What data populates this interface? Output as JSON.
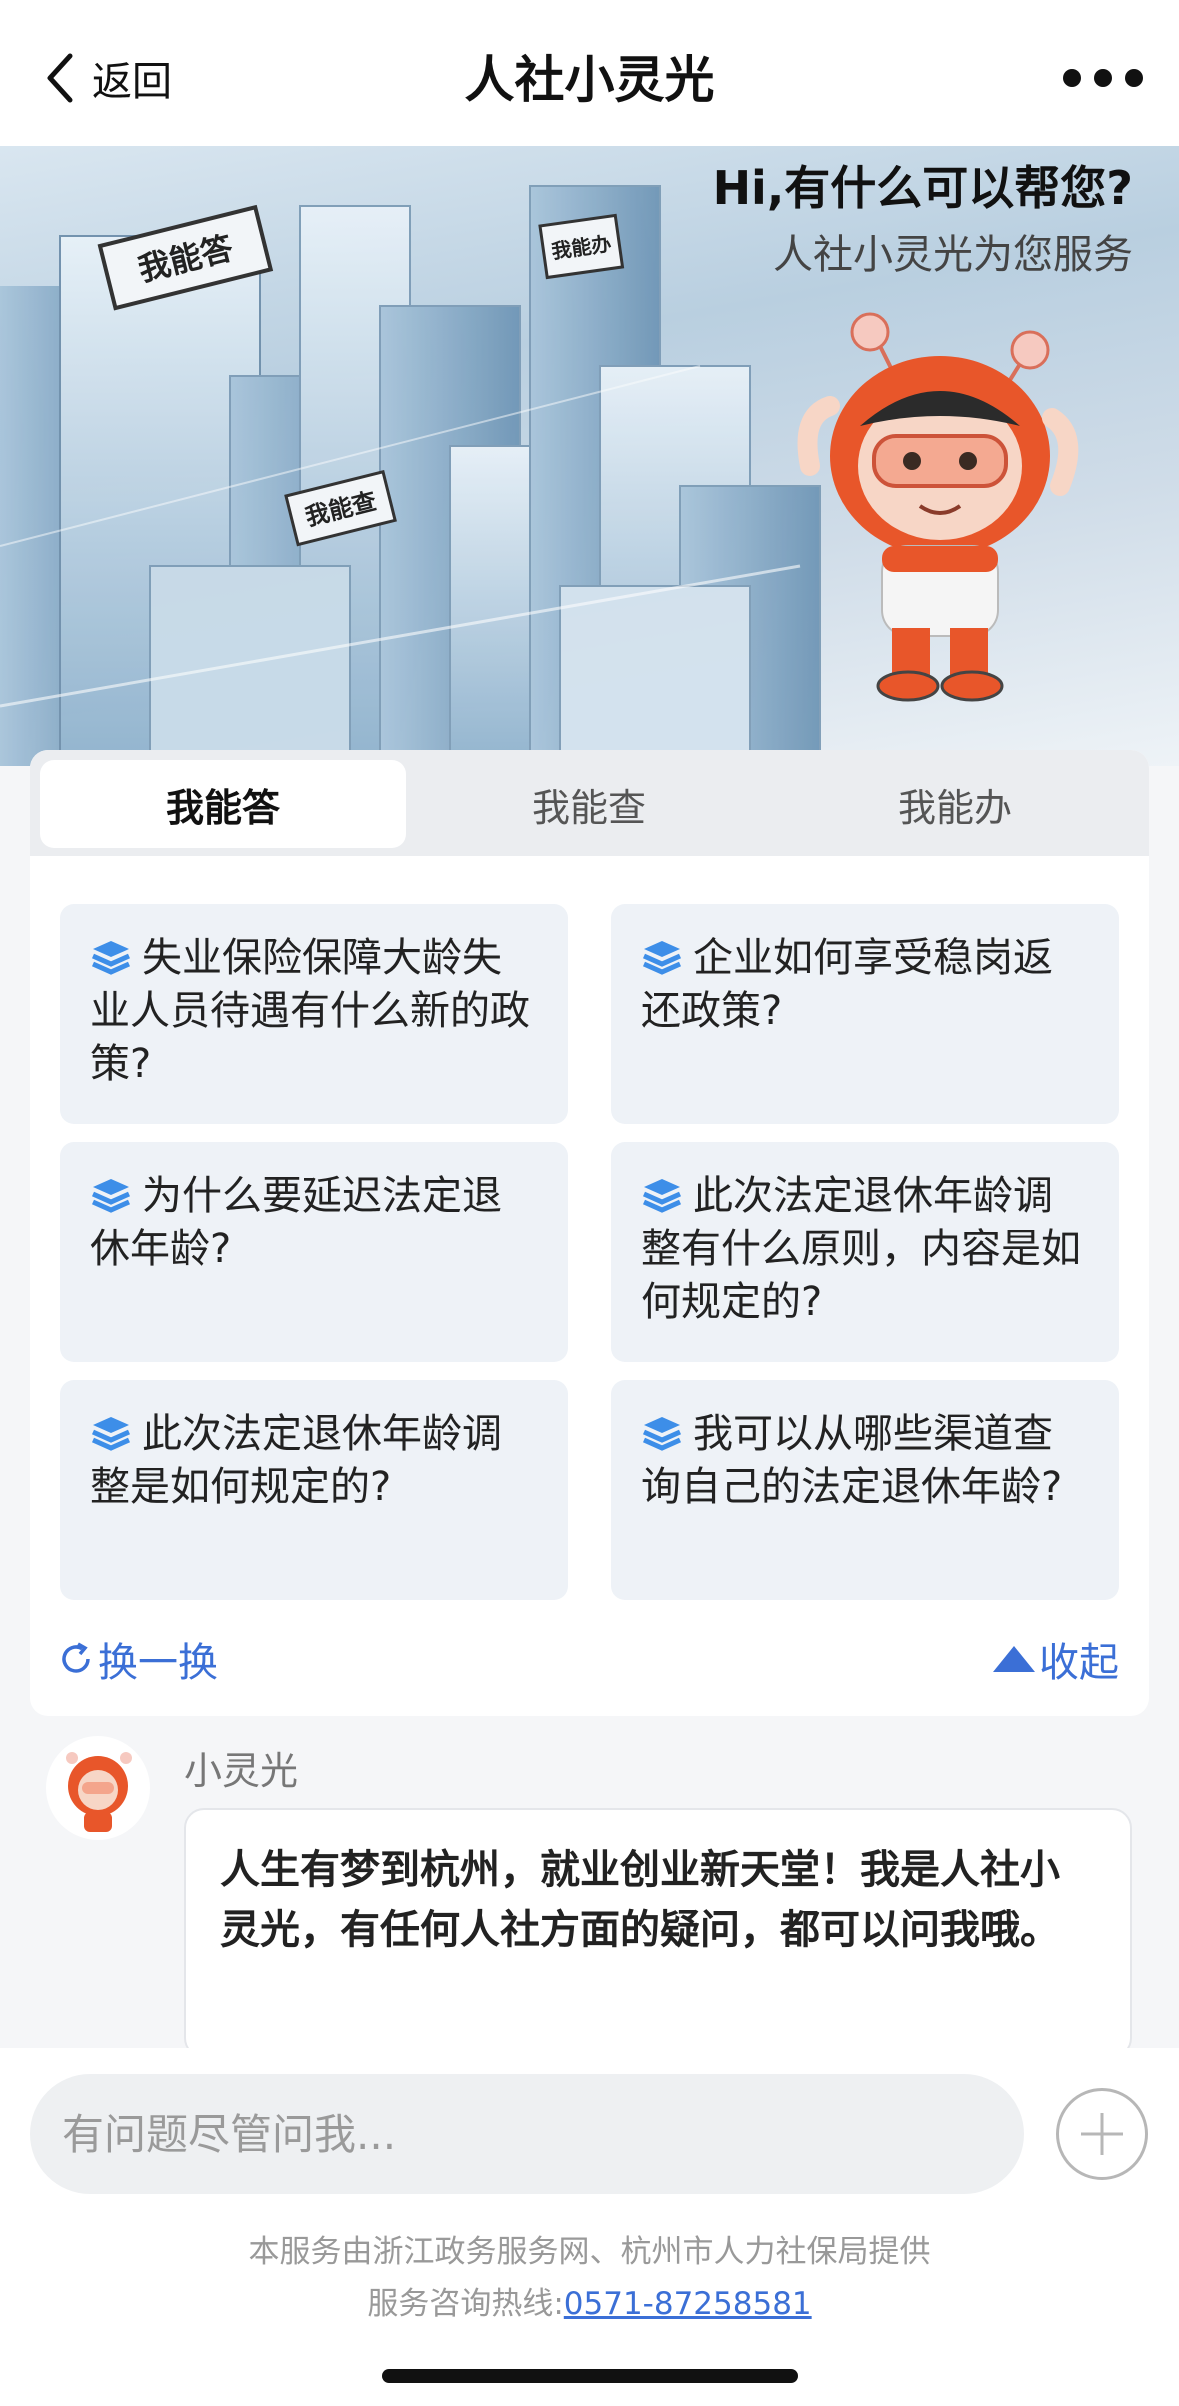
{
  "nav": {
    "back_label": "返回",
    "title": "人社小灵光"
  },
  "hero": {
    "greeting": "Hi,有什么可以帮您?",
    "subtitle": "人社小灵光为您服务",
    "signs": [
      "我能答",
      "我能办",
      "我能查"
    ]
  },
  "tabs": [
    {
      "label": "我能答",
      "active": true
    },
    {
      "label": "我能查",
      "active": false
    },
    {
      "label": "我能办",
      "active": false
    }
  ],
  "questions": [
    "失业保险保障大龄失业人员待遇有什么新的政策?",
    "企业如何享受稳岗返还政策?",
    "为什么要延迟法定退休年龄?",
    "此次法定退休年龄调整有什么原则，内容是如何规定的?",
    "此次法定退休年龄调整是如何规定的?",
    "我可以从哪些渠道查询自己的法定退休年龄?"
  ],
  "actions": {
    "refresh_label": "换一换",
    "collapse_label": "收起"
  },
  "chat": {
    "sender": "小灵光",
    "message": "人生有梦到杭州，就业创业新天堂！我是人社小灵光，有任何人社方面的疑问，都可以问我哦。"
  },
  "input": {
    "placeholder": "有问题尽管问我..."
  },
  "footer": {
    "provider": "本服务由浙江政务服务网、杭州市人力社保局提供",
    "hotline_label": "服务咨询热线:",
    "hotline_number": "0571-87258581"
  },
  "colors": {
    "accent": "#3b6fd6",
    "mascot_orange": "#e8562a"
  },
  "icons": [
    "chevron-left-icon",
    "more-dots-icon",
    "layers-icon",
    "refresh-icon",
    "triangle-up-icon",
    "plus-icon"
  ]
}
